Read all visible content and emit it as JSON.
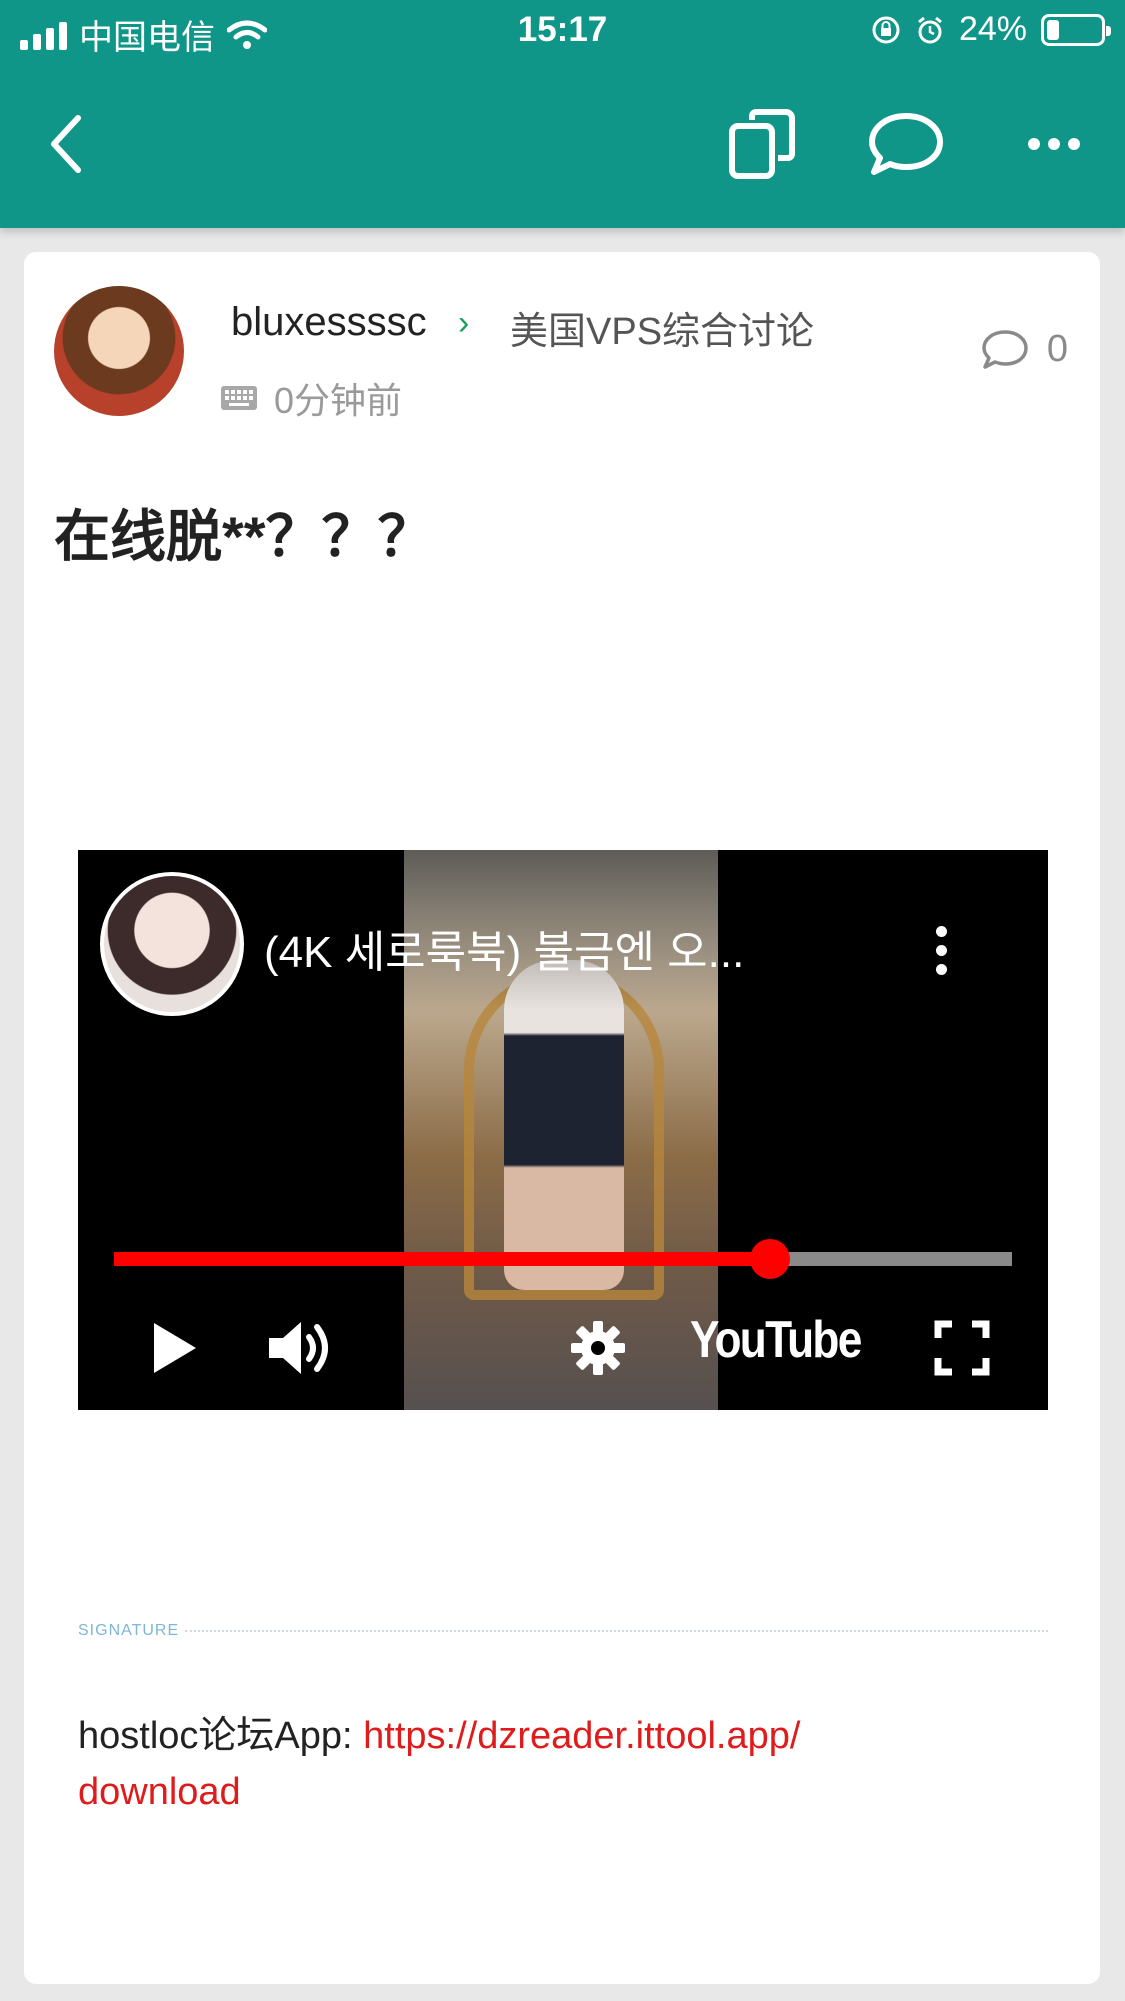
{
  "status_bar": {
    "carrier": "中国电信",
    "time": "15:17",
    "battery": "24%",
    "battery_level": 0.24,
    "icons": [
      "signal-icon",
      "wifi-icon",
      "orientation-lock-icon",
      "alarm-icon",
      "battery-icon"
    ]
  },
  "header": {
    "icons": [
      "back-icon",
      "copy-icon",
      "comment-icon",
      "more-icon"
    ]
  },
  "post": {
    "username": "bluxessssc",
    "forum": "美国VPS综合讨论",
    "time": "0分钟前",
    "reply_count": "0",
    "title": "在线脱**？？？"
  },
  "video": {
    "title": "(4K 세로룩북) 불금엔 오...",
    "brand": "YouTube",
    "progress": 0.73,
    "colors": {
      "progress": "#ff0000",
      "track": "#8a8a8a"
    }
  },
  "signature": {
    "label": "SIGNATURE",
    "prefix": "hostloc论坛App: ",
    "link": "https://dzreader.ittool.app/download",
    "link_line1": "https://dzreader.ittool.app/",
    "link_line2": "download"
  },
  "colors": {
    "header": "#0f9688",
    "link": "#e01b1b",
    "forum_chevron": "#1aa05a"
  }
}
